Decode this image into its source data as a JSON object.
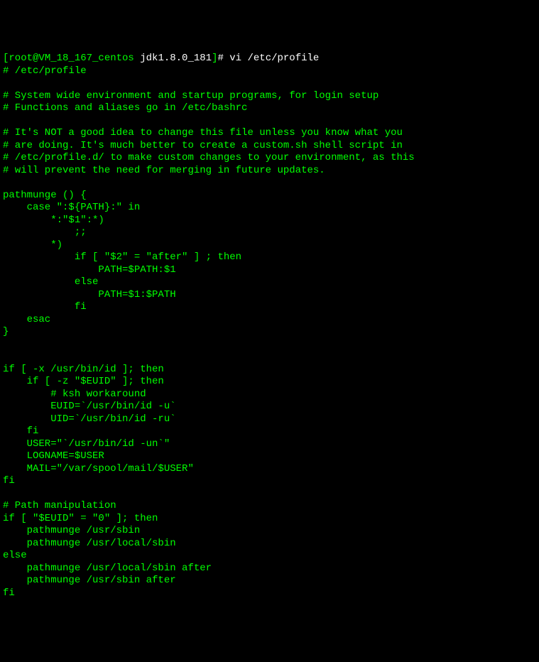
{
  "prompt": {
    "bracket_open": "[",
    "user_host": "root@VM_18_167_centos",
    "cwd": " jdk1.8.0_181",
    "bracket_close": "]",
    "hash": "# ",
    "command": "vi /etc/profile"
  },
  "lines": [
    "# /etc/profile",
    "",
    "# System wide environment and startup programs, for login setup",
    "# Functions and aliases go in /etc/bashrc",
    "",
    "# It's NOT a good idea to change this file unless you know what you",
    "# are doing. It's much better to create a custom.sh shell script in",
    "# /etc/profile.d/ to make custom changes to your environment, as this",
    "# will prevent the need for merging in future updates.",
    "",
    "pathmunge () {",
    "    case \":${PATH}:\" in",
    "        *:\"$1\":*)",
    "            ;;",
    "        *)",
    "            if [ \"$2\" = \"after\" ] ; then",
    "                PATH=$PATH:$1",
    "            else",
    "                PATH=$1:$PATH",
    "            fi",
    "    esac",
    "}",
    "",
    "",
    "if [ -x /usr/bin/id ]; then",
    "    if [ -z \"$EUID\" ]; then",
    "        # ksh workaround",
    "        EUID=`/usr/bin/id -u`",
    "        UID=`/usr/bin/id -ru`",
    "    fi",
    "    USER=\"`/usr/bin/id -un`\"",
    "    LOGNAME=$USER",
    "    MAIL=\"/var/spool/mail/$USER\"",
    "fi",
    "",
    "# Path manipulation",
    "if [ \"$EUID\" = \"0\" ]; then",
    "    pathmunge /usr/sbin",
    "    pathmunge /usr/local/sbin",
    "else",
    "    pathmunge /usr/local/sbin after",
    "    pathmunge /usr/sbin after",
    "fi"
  ]
}
